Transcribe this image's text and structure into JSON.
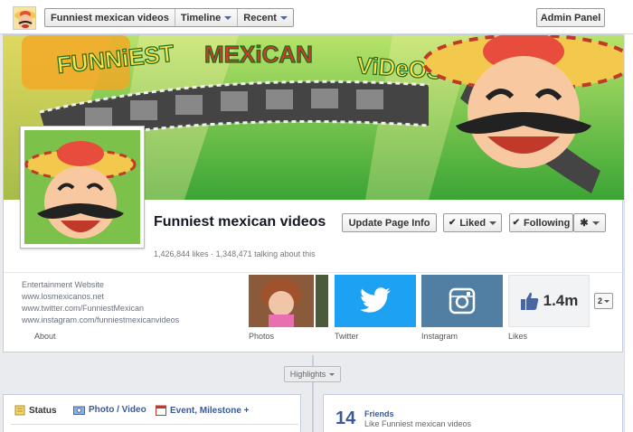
{
  "topbar": {
    "page_name_tab": "Funniest mexican videos",
    "timeline_tab": "Timeline",
    "recent_tab": "Recent",
    "admin_panel": "Admin Panel"
  },
  "cover": {
    "banner_text_1": "FUNNiEST",
    "banner_text_2": "MEXiCAN",
    "banner_text_3": "ViDeOS",
    "colors": {
      "sky": "#2fa33a",
      "banner_red": "#d23a2a",
      "banner_yellow": "#ffe04a",
      "stripe": "#f5a623"
    }
  },
  "page": {
    "name": "Funniest mexican videos",
    "likes": "1,426,844 likes",
    "separator": "·",
    "talking": "1,348,471 talking about this"
  },
  "actions": {
    "update_info": "Update Page Info",
    "liked": "Liked",
    "following": "Following"
  },
  "about": {
    "category": "Entertainment Website",
    "links": [
      "www.losmexicanos.net",
      "www.twitter.com/FunniestMexican",
      "www.instagram.com/funniestmexicanvideos"
    ],
    "label": "About"
  },
  "tiles": {
    "photos_label": "Photos",
    "twitter_label": "Twitter",
    "instagram_label": "Instagram",
    "likes_value": "1.4m",
    "likes_label": "Likes",
    "more_count": "2"
  },
  "highlights": {
    "label": "Highlights"
  },
  "composer": {
    "status": "Status",
    "photo_video": "Photo / Video",
    "event": "Event, Milestone +"
  },
  "friends": {
    "count": "14",
    "label": "Friends",
    "sub": "Like Funniest mexican videos"
  }
}
